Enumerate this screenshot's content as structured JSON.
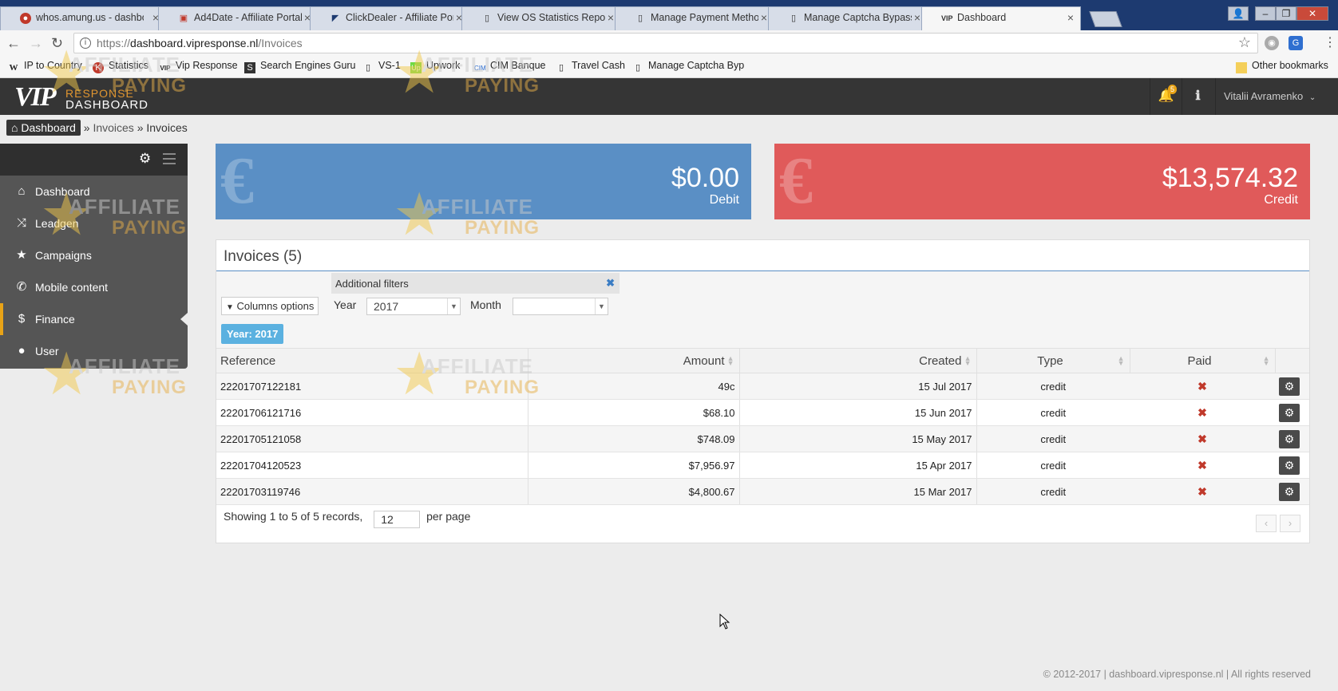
{
  "browser": {
    "tabs": [
      {
        "title": "whos.amung.us - dashbo",
        "icon": "amung-icon"
      },
      {
        "title": "Ad4Date - Affiliate Portal",
        "icon": "ad4date-icon"
      },
      {
        "title": "ClickDealer - Affiliate Por",
        "icon": "clickdealer-icon"
      },
      {
        "title": "View OS Statistics Report",
        "icon": "page-icon"
      },
      {
        "title": "Manage Payment Metho",
        "icon": "page-icon"
      },
      {
        "title": "Manage Captcha Bypass",
        "icon": "page-icon"
      },
      {
        "title": "Dashboard",
        "icon": "vip-icon"
      }
    ],
    "url_prefix": "https://",
    "url_host": "dashboard.vipresponse.nl",
    "url_path": "/Invoices",
    "bookmarks": [
      {
        "label": "IP to Country",
        "icon": "w-icon"
      },
      {
        "label": "Statistics",
        "icon": "k-icon"
      },
      {
        "label": "Vip Response",
        "icon": "vip-icon"
      },
      {
        "label": "Search Engines Guru",
        "icon": "seg-icon"
      },
      {
        "label": "VS-1",
        "icon": "page-icon"
      },
      {
        "label": "Upwork",
        "icon": "upwork-icon"
      },
      {
        "label": "CIM Banque",
        "icon": "cim-icon"
      },
      {
        "label": "Travel Cash",
        "icon": "page-icon"
      },
      {
        "label": "Manage Captcha Byp",
        "icon": "page-icon"
      }
    ],
    "other_bookmarks": "Other bookmarks"
  },
  "header": {
    "logo_vip": "VIP",
    "logo_response": "RESPONSE",
    "logo_dashboard": "DASHBOARD",
    "notification_count": "5",
    "user_name": "Vitalii Avramenko"
  },
  "breadcrumb": {
    "home": "Dashboard",
    "sep1": "»",
    "level1": "Invoices",
    "sep2": "»",
    "current": "Invoices"
  },
  "sidebar": {
    "items": [
      {
        "label": "Dashboard",
        "icon": "home-icon"
      },
      {
        "label": "Leadgen",
        "icon": "shuffle-icon"
      },
      {
        "label": "Campaigns",
        "icon": "star-icon"
      },
      {
        "label": "Mobile content",
        "icon": "phone-icon"
      },
      {
        "label": "Finance",
        "icon": "dollar-icon"
      },
      {
        "label": "User",
        "icon": "user-icon"
      }
    ],
    "active": "Finance"
  },
  "stats": {
    "debit_amount": "$0.00",
    "debit_label": "Debit",
    "credit_amount": "$13,574.32",
    "credit_label": "Credit"
  },
  "invoices": {
    "title": "Invoices (5)",
    "additional_filters": "Additional filters",
    "columns_options": "Columns options",
    "year_label": "Year",
    "year_value": "2017",
    "month_label": "Month",
    "month_value": "",
    "active_filter": "Year: 2017",
    "columns": [
      "Reference",
      "Amount",
      "Created",
      "Type",
      "Paid"
    ],
    "rows": [
      {
        "reference": "22201707122181",
        "amount": "49c",
        "created": "15 Jul 2017",
        "type": "credit",
        "paid": "✖"
      },
      {
        "reference": "22201706121716",
        "amount": "$68.10",
        "created": "15 Jun 2017",
        "type": "credit",
        "paid": "✖"
      },
      {
        "reference": "22201705121058",
        "amount": "$748.09",
        "created": "15 May 2017",
        "type": "credit",
        "paid": "✖"
      },
      {
        "reference": "22201704120523",
        "amount": "$7,956.97",
        "created": "15 Apr 2017",
        "type": "credit",
        "paid": "✖"
      },
      {
        "reference": "22201703119746",
        "amount": "$4,800.67",
        "created": "15 Mar 2017",
        "type": "credit",
        "paid": "✖"
      }
    ],
    "showing": "Showing 1 to 5 of 5 records,",
    "per_page_value": "12",
    "per_page_label": "per page"
  },
  "watermark": {
    "line1": "AFFILIATE",
    "line2": "PAYING"
  },
  "footer": "© 2012-2017 | dashboard.vipresponse.nl | All rights reserved",
  "colors": {
    "debit": "#5a8fc5",
    "credit": "#e05a5a",
    "accent": "#e8a317",
    "header": "#353535"
  }
}
